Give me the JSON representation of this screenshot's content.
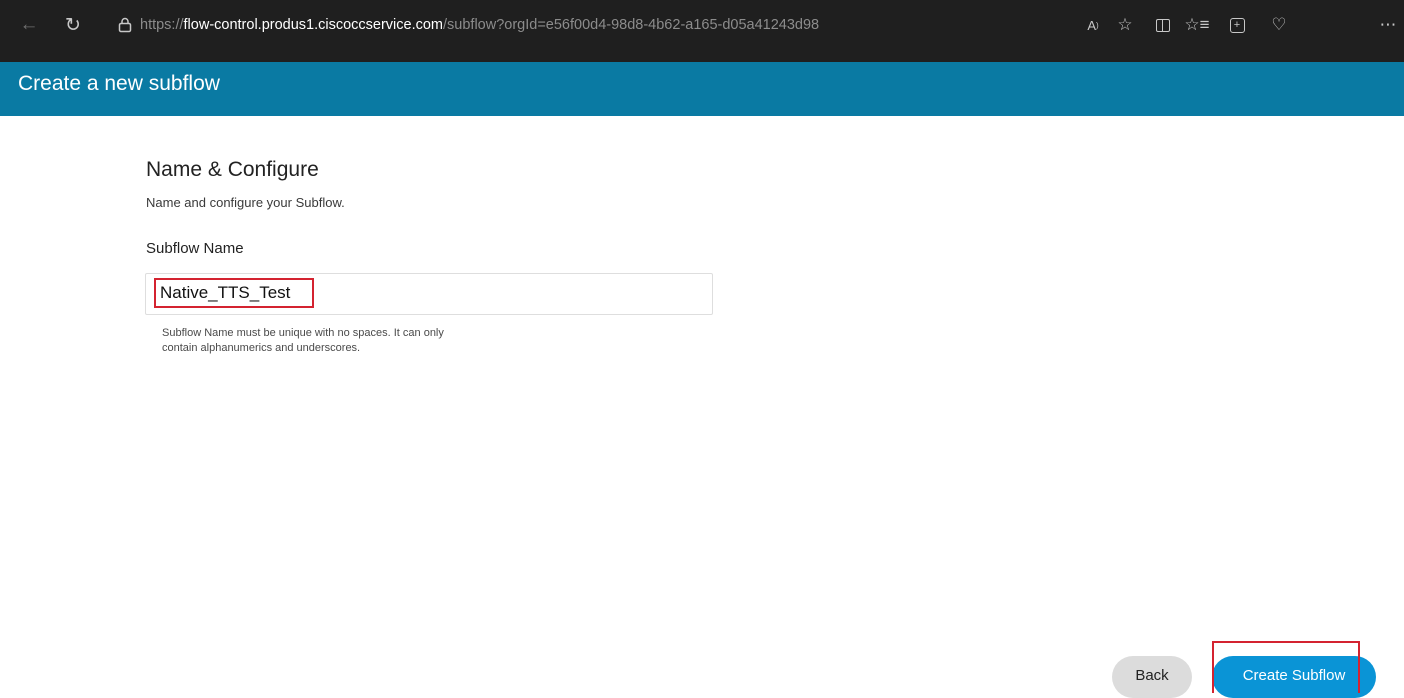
{
  "browser": {
    "url": {
      "prefix": "https://",
      "domain": "flow-control.produs1.ciscoccservice.com",
      "path": "/subflow?orgId=e56f00d4-98d8-4b62-a165-d05a41243d98"
    },
    "icons": {
      "back": "back-arrow-icon",
      "refresh": "refresh-icon",
      "lock": "lock-icon",
      "read_aloud": "read-aloud-icon",
      "favorite": "favorite-star-icon",
      "split_screen": "split-screen-icon",
      "favorites": "favorites-list-icon",
      "collections": "collections-icon",
      "browser_essentials": "browser-essentials-icon",
      "more": "more-icon"
    }
  },
  "header": {
    "title": "Create a new subflow",
    "background": "#0a7aa3"
  },
  "form": {
    "section_title": "Name & Configure",
    "section_subtitle": "Name and configure your Subflow.",
    "field_label": "Subflow Name",
    "field_value": "Native_TTS_Test",
    "helper_line1": "Subflow Name must be unique with no spaces. It can only",
    "helper_line2": "contain alphanumerics and underscores."
  },
  "actions": {
    "back_label": "Back",
    "create_label": "Create Subflow",
    "primary_color": "#0a94d6",
    "highlight_color": "#d42330"
  }
}
